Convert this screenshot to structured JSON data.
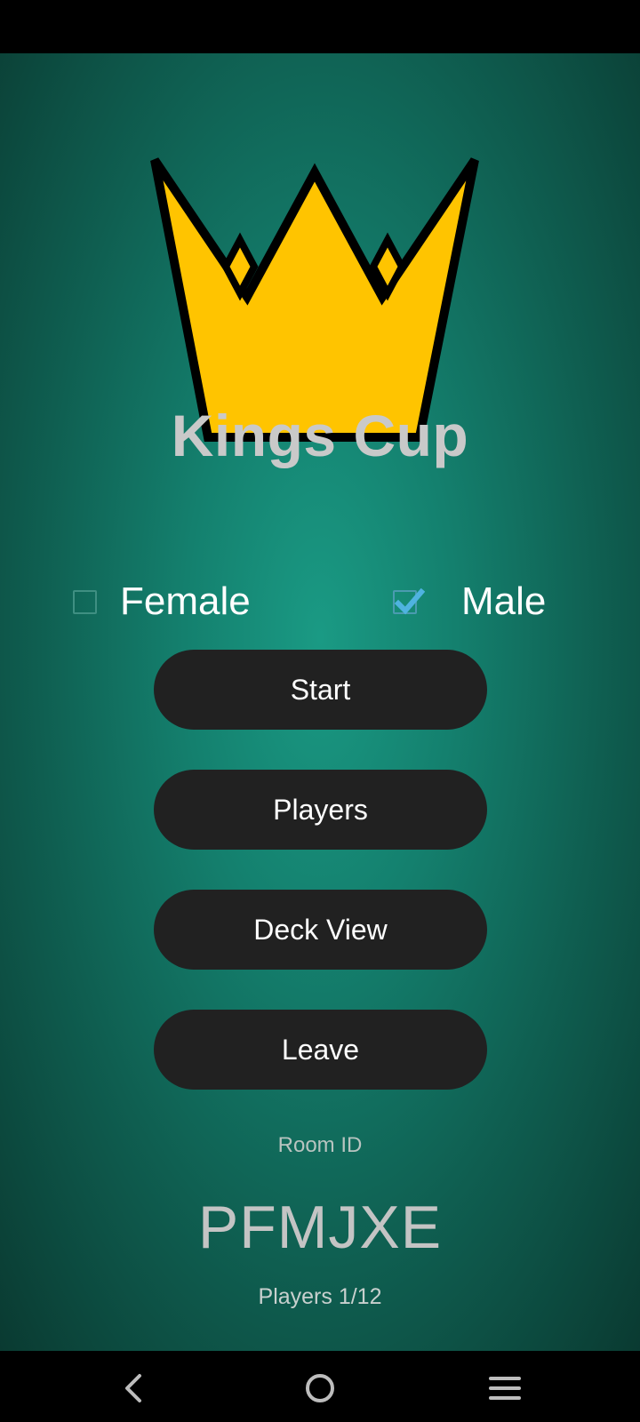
{
  "app": {
    "title": "Kings Cup"
  },
  "gender": {
    "female_label": "Female",
    "female_checked": false,
    "male_label": "Male",
    "male_checked": true
  },
  "buttons": {
    "start": "Start",
    "players": "Players",
    "deck_view": "Deck View",
    "leave": "Leave"
  },
  "room": {
    "label": "Room ID",
    "id": "PFMJXE",
    "players_count": "Players 1/12"
  },
  "icons": {
    "logo": "crown-icon",
    "checkmark": "check-icon",
    "nav_back": "back-icon",
    "nav_home": "home-icon",
    "nav_menu": "menu-icon"
  },
  "colors": {
    "background_center": "#1a9a84",
    "background_edge": "#0a3a31",
    "crown": "#ffc400",
    "button": "#212121",
    "title": "#c9c9c9",
    "check": "#4fb3e0"
  }
}
